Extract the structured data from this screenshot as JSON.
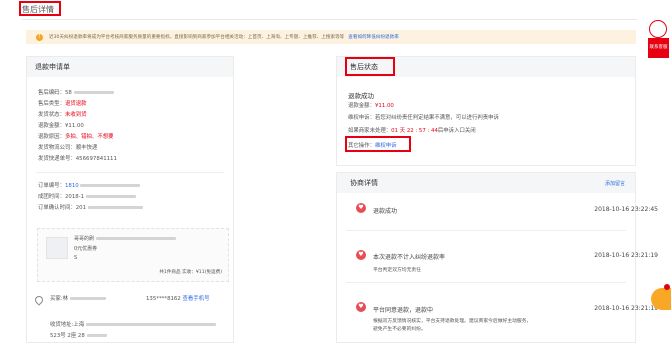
{
  "page_title": "售后详情",
  "notice": {
    "text": "近30天纠纷退款率将成为平台考核商家服务质量的重要指标，直接影响到商家参加平台相关活动：上首页、上海淘、上专题、上推荐、上搜索等等",
    "link": "查看如何降低纠纷退款率"
  },
  "left_panel": {
    "title": "退款申请单",
    "fields": [
      {
        "label": "售后编码：",
        "value": "58"
      },
      {
        "label": "售后类型：",
        "value": "退货退款"
      },
      {
        "label": "发货状态：",
        "value": "未收到货"
      },
      {
        "label": "退款金额：",
        "value": "¥11.00"
      },
      {
        "label": "退款原因：",
        "value": "多拍、错拍、不想要"
      },
      {
        "label": "发货物流公司：",
        "value": "顺丰快递"
      },
      {
        "label": "发货快递单号：",
        "value": "456697841111"
      }
    ],
    "order": {
      "number_label": "订单编号：",
      "number_value": "1810",
      "created_label": "成团时间：",
      "created_value": "2018-1",
      "confirmed_label": "订单确认时间：",
      "confirmed_value": "201"
    },
    "product": {
      "name": "哥哥的刷",
      "coupon": "0元优惠券",
      "sku": "S",
      "summary": "共1件商品  实收：¥11(免运费)"
    },
    "buyer": {
      "label": "买家:林",
      "phone": "135****8162",
      "phone_link": "查看手机号"
    },
    "address": {
      "label": "收货地址:上海",
      "line2": "523号 2座 28"
    }
  },
  "status_panel": {
    "title": "售后状态",
    "headline": "退款成功",
    "amount_label": "退款金额：",
    "amount_value": "¥11.00",
    "hint": "维权申诉：若您对纠纷责任判定结果不满意，可以进行判责申诉",
    "deadline_prefix": "如果商家未处理：",
    "deadline_value": "01 天 22 : 57 : 44",
    "deadline_suffix": "后申诉入口关闭",
    "other_label": "其它操作：",
    "other_link": "维权申诉"
  },
  "negotiation": {
    "title": "协商详情",
    "action": "添加留言",
    "items": [
      {
        "text": "退款成功",
        "time": "2018-10-16 23:22:45",
        "sub": ""
      },
      {
        "text": "本次退款不计入纠纷退款率",
        "time": "2018-10-16 23:21:19",
        "sub": "平台判定双方均无责任"
      },
      {
        "text": "平台同意退款，退款中",
        "time": "2018-10-16 23:21:19",
        "sub": "根据双方反馈情况核实，平台支持退款处理。建议商家今后做好主动服务，避免产生不必要的纠纷。"
      }
    ]
  },
  "side": {
    "service_tab": "联系客服"
  },
  "colors": {
    "highlight": "#e60012",
    "link": "#2d6ae0",
    "notice_bg": "#fdf2df",
    "chat_bubble": "#f9a825"
  }
}
